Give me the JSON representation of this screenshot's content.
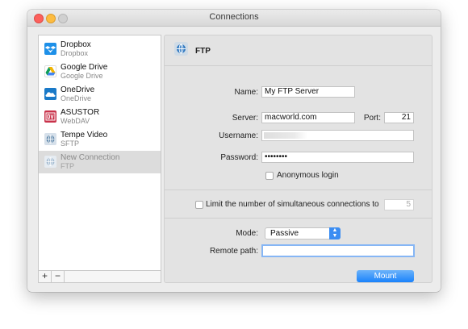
{
  "window": {
    "title": "Connections"
  },
  "sidebar": {
    "items": [
      {
        "name": "Dropbox",
        "sub": "Dropbox",
        "icon": "dropbox-icon",
        "color": "#1e90e8"
      },
      {
        "name": "Google Drive",
        "sub": "Google Drive",
        "icon": "google-drive-icon",
        "color": "#4aa34a"
      },
      {
        "name": "OneDrive",
        "sub": "OneDrive",
        "icon": "onedrive-icon",
        "color": "#1979c8"
      },
      {
        "name": "ASUSTOR",
        "sub": "WebDAV",
        "icon": "webdav-icon",
        "color": "#c8324a"
      },
      {
        "name": "Tempe Video",
        "sub": "SFTP",
        "icon": "sftp-icon",
        "color": "#6a8fb0"
      },
      {
        "name": "New Connection",
        "sub": "FTP",
        "icon": "ftp-icon",
        "color": "#9bb3c8",
        "selected": true
      }
    ],
    "add_label": "+",
    "remove_label": "−"
  },
  "detail": {
    "header_title": "FTP",
    "header_icon": "ftp-globe-icon",
    "name_label": "Name:",
    "name_value": "My FTP Server",
    "server_label": "Server:",
    "server_value": "macworld.com",
    "port_label": "Port:",
    "port_value": "21",
    "username_label": "Username:",
    "password_label": "Password:",
    "password_value": "••••••••",
    "anonymous_label": "Anonymous login",
    "anonymous_checked": false,
    "limit_label": "Limit the number of simultaneous connections to",
    "limit_checked": false,
    "limit_value": "5",
    "mode_label": "Mode:",
    "mode_value": "Passive",
    "remote_path_label": "Remote path:",
    "remote_path_value": "",
    "mount_label": "Mount"
  }
}
